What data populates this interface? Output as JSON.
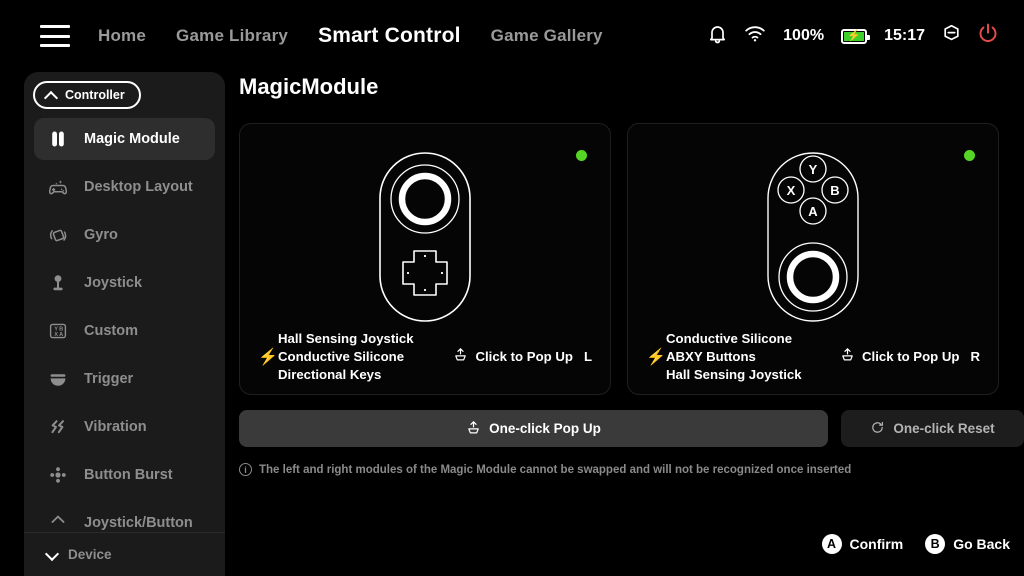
{
  "topbar": {
    "menu_icon": "hamburger-icon",
    "nav": [
      {
        "label": "Home",
        "active": false
      },
      {
        "label": "Game Library",
        "active": false
      },
      {
        "label": "Smart Control",
        "active": true
      },
      {
        "label": "Game Gallery",
        "active": false
      }
    ],
    "status": {
      "bell_icon": "bell-icon",
      "wifi_icon": "wifi-icon",
      "battery_percent": "100%",
      "battery_icon": "battery-charging-icon",
      "time": "15:17",
      "minimize_icon": "minimize-icon",
      "power_icon": "power-icon",
      "power_color": "#e04a4a",
      "battery_color": "#3ecf2a"
    }
  },
  "sidebar": {
    "header": {
      "label": "Controller",
      "icon": "chevron-up-icon"
    },
    "items": [
      {
        "label": "Magic Module",
        "icon": "magic-module-icon",
        "active": true
      },
      {
        "label": "Desktop Layout",
        "icon": "gamepad-sparkle-icon",
        "active": false
      },
      {
        "label": "Gyro",
        "icon": "gyro-icon",
        "active": false
      },
      {
        "label": "Joystick",
        "icon": "joystick-icon",
        "active": false
      },
      {
        "label": "Custom",
        "icon": "abxy-keys-icon",
        "active": false
      },
      {
        "label": "Trigger",
        "icon": "trigger-icon",
        "active": false
      },
      {
        "label": "Vibration",
        "icon": "vibration-icon",
        "active": false
      },
      {
        "label": "Button Burst",
        "icon": "button-burst-icon",
        "active": false
      },
      {
        "label": "Joystick/Button",
        "icon": "joystick-button-icon",
        "active": false
      }
    ],
    "footer": {
      "label": "Device",
      "icon": "chevron-down-icon"
    }
  },
  "main": {
    "title": "MagicModule",
    "cards": [
      {
        "status_dot_color": "#55d626",
        "art": "left-module-joystick-dpad",
        "bolt_icon": "lightning-icon",
        "spec_lines": [
          "Hall Sensing Joystick",
          "Conductive Silicone",
          "Directional Keys"
        ],
        "popup_label": "Click to Pop Up",
        "popup_icon": "pop-up-icon",
        "side": "L"
      },
      {
        "status_dot_color": "#55d626",
        "art": "right-module-abxy-joystick",
        "bolt_icon": "lightning-icon",
        "spec_lines": [
          "Conductive Silicone",
          "ABXY Buttons",
          "Hall Sensing Joystick"
        ],
        "popup_label": "Click to Pop Up",
        "popup_icon": "pop-up-icon",
        "side": "R"
      }
    ],
    "buttons": {
      "primary": {
        "label": "One-click Pop Up",
        "icon": "pop-up-icon"
      },
      "secondary": {
        "label": "One-click Reset",
        "icon": "reset-icon"
      }
    },
    "note": "The left and right modules of the Magic Module cannot be swapped and will not be recognized once inserted",
    "note_icon": "info-icon",
    "hints": [
      {
        "key": "A",
        "label": "Confirm"
      },
      {
        "key": "B",
        "label": "Go Back"
      }
    ]
  },
  "module_art": {
    "left": {
      "dpad_labels": []
    },
    "right": {
      "button_labels": [
        "Y",
        "X",
        "B",
        "A"
      ]
    }
  }
}
